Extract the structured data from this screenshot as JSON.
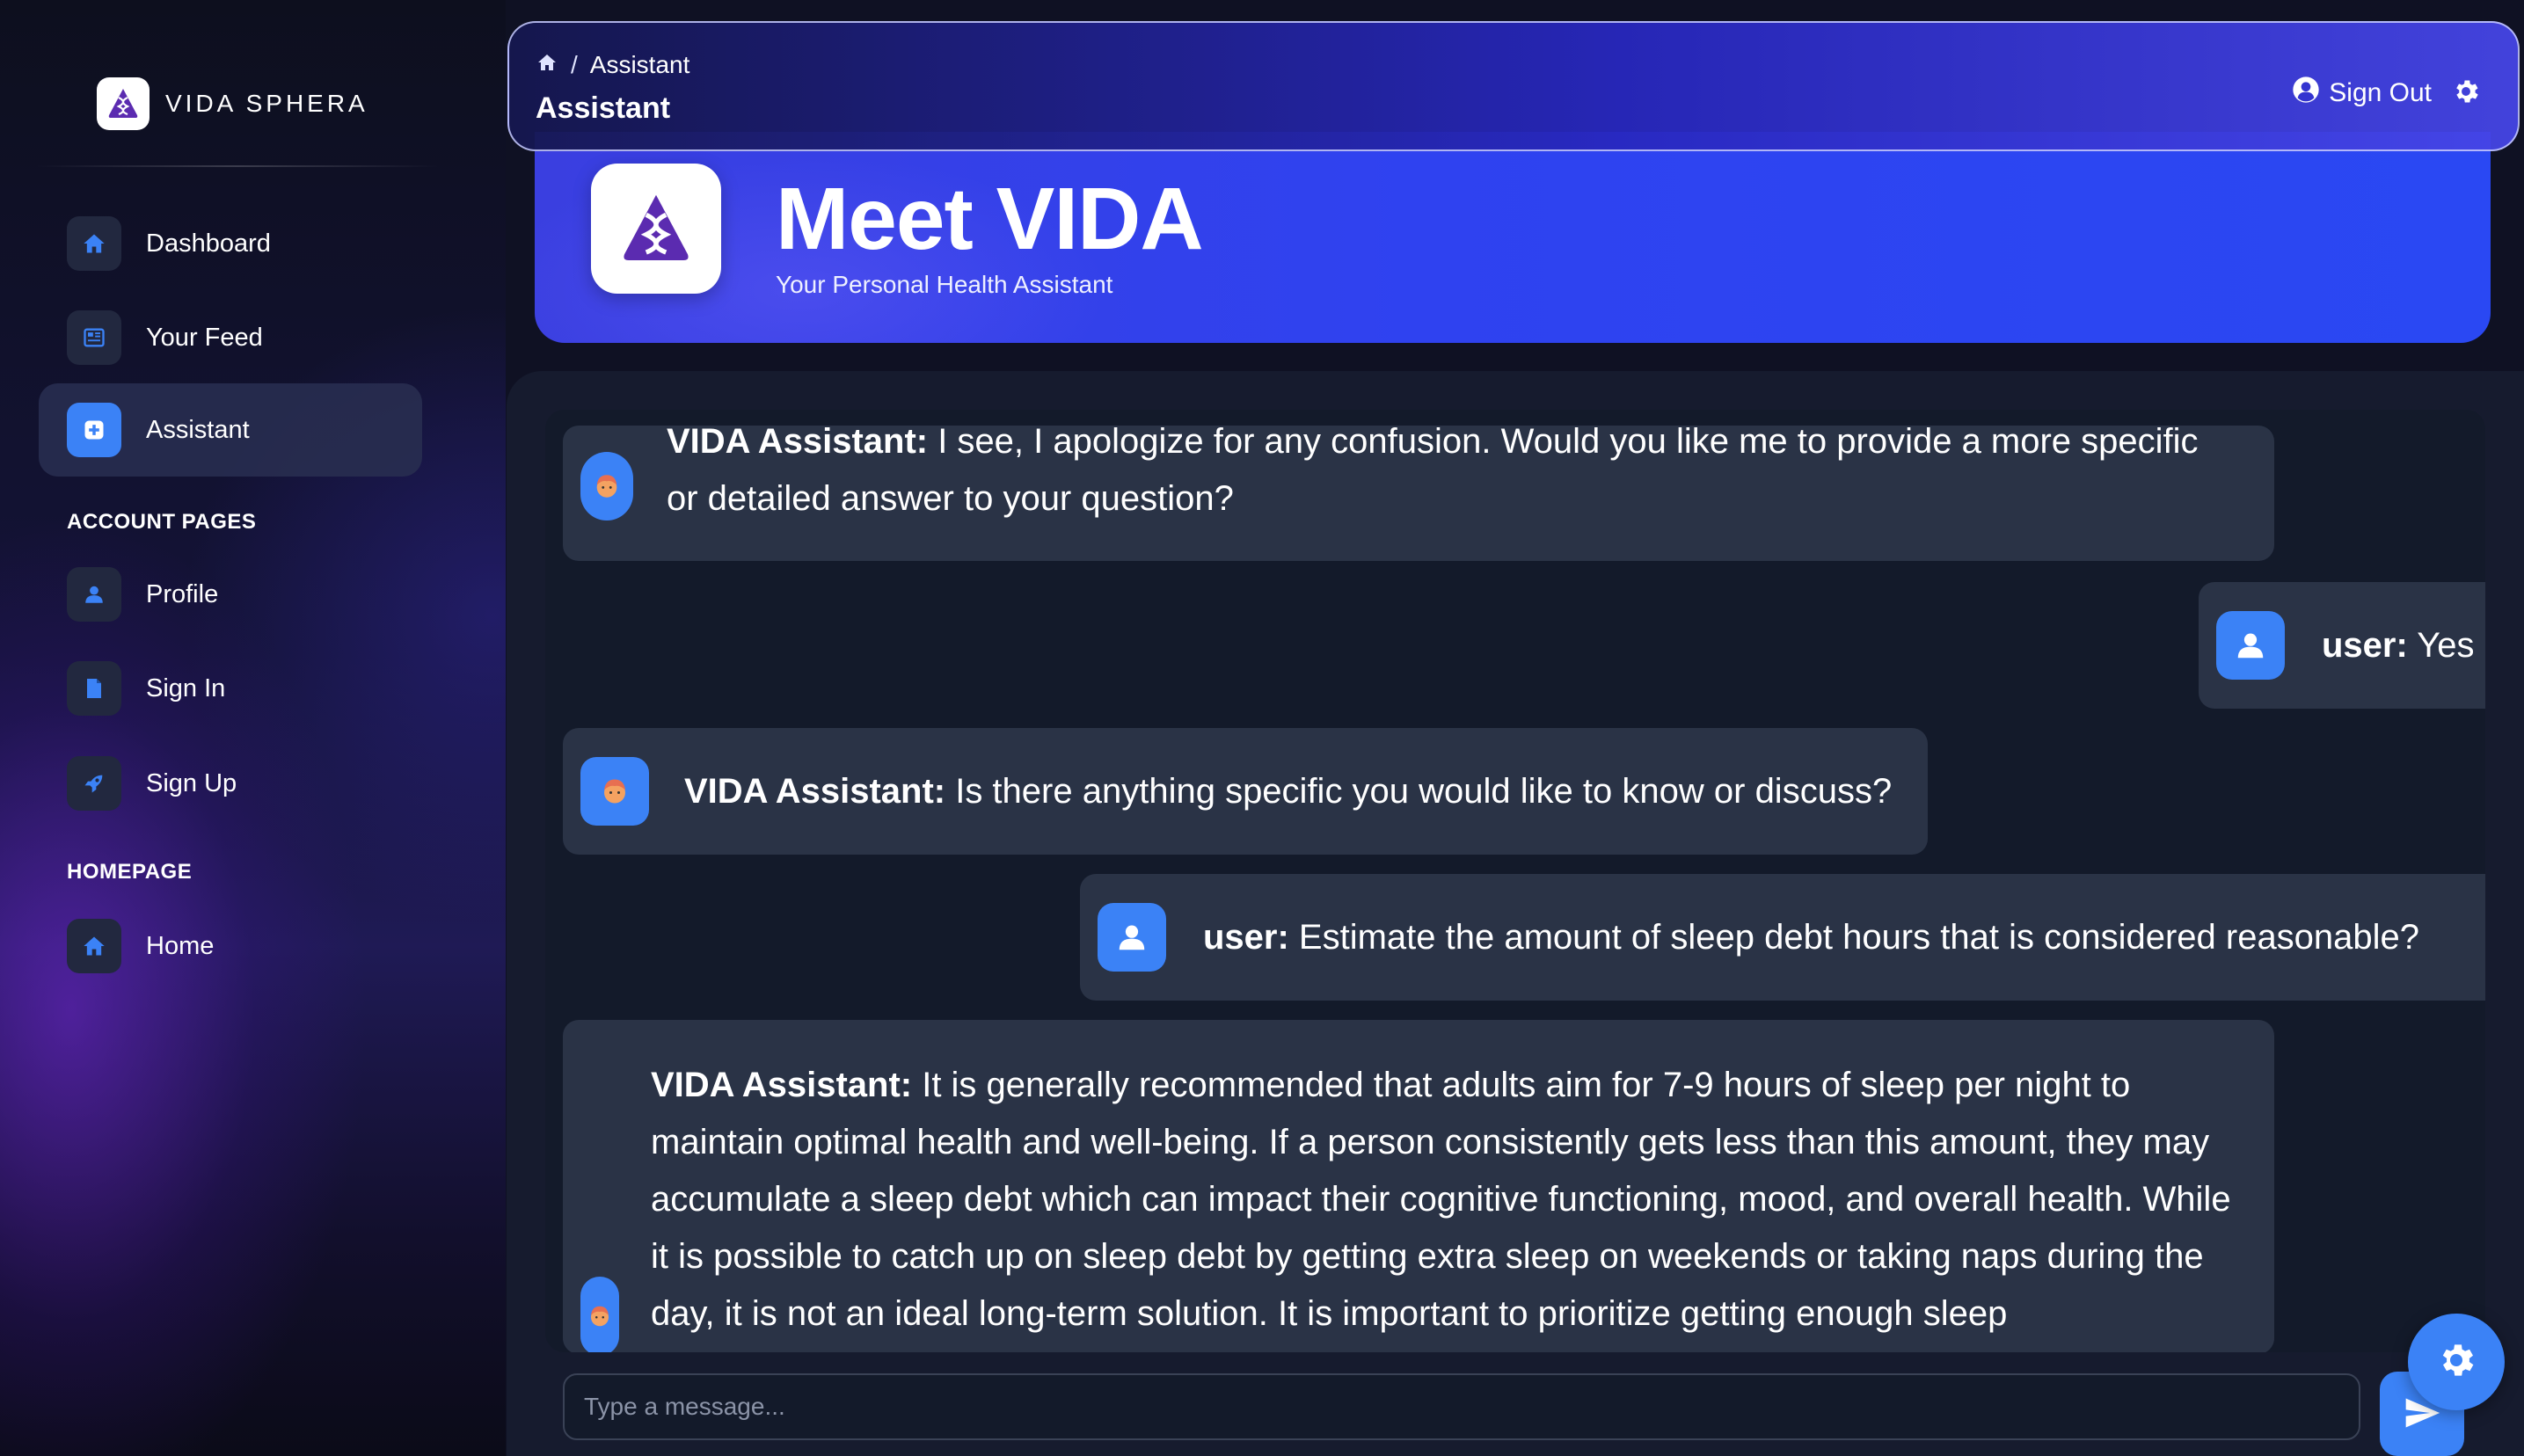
{
  "brand": {
    "name": "VIDA SPHERA",
    "logo_icon": "dna-flask-icon"
  },
  "sidebar": {
    "items": [
      {
        "label": "Dashboard",
        "icon": "home-icon",
        "active": false
      },
      {
        "label": "Your Feed",
        "icon": "feed-icon",
        "active": false
      },
      {
        "label": "Assistant",
        "icon": "assistant-icon",
        "active": true
      }
    ],
    "account_title": "ACCOUNT PAGES",
    "account_items": [
      {
        "label": "Profile",
        "icon": "user-icon"
      },
      {
        "label": "Sign In",
        "icon": "document-icon"
      },
      {
        "label": "Sign Up",
        "icon": "rocket-icon"
      }
    ],
    "homepage_title": "HOMEPAGE",
    "homepage_items": [
      {
        "label": "Home",
        "icon": "home-icon"
      }
    ]
  },
  "topbar": {
    "breadcrumb": {
      "root_icon": "home-icon",
      "separator": "/",
      "current": "Assistant"
    },
    "page_title": "Assistant",
    "sign_out_label": "Sign Out"
  },
  "hero": {
    "title": "Meet VIDA",
    "subtitle": "Your Personal Health Assistant"
  },
  "chat": {
    "messages": [
      {
        "sender": "VIDA Assistant:",
        "text": " I see, I apologize for any confusion. Would you like me to provide a more specific or detailed answer to your question?",
        "role": "assistant"
      },
      {
        "sender": "user:",
        "text": " Yes",
        "role": "user"
      },
      {
        "sender": "VIDA Assistant:",
        "text": " Is there anything specific you would like to know or discuss?",
        "role": "assistant"
      },
      {
        "sender": "user:",
        "text": " Estimate the amount of sleep debt hours that is considered reasonable?",
        "role": "user"
      },
      {
        "sender": "VIDA Assistant:",
        "text": " It is generally recommended that adults aim for 7-9 hours of sleep per night to maintain optimal health and well-being. If a person consistently gets less than this amount, they may accumulate a sleep debt which can impact their cognitive functioning, mood, and overall health. While it is possible to catch up on sleep debt by getting extra sleep on weekends or taking naps during the day, it is not an ideal long-term solution. It is important to prioritize getting enough sleep",
        "role": "assistant"
      }
    ],
    "input_placeholder": "Type a message...",
    "input_value": ""
  },
  "colors": {
    "accent": "#3b82f6",
    "hero_blue": "#2f42f0",
    "bubble": "#2a3346",
    "panel": "#161b2e"
  }
}
